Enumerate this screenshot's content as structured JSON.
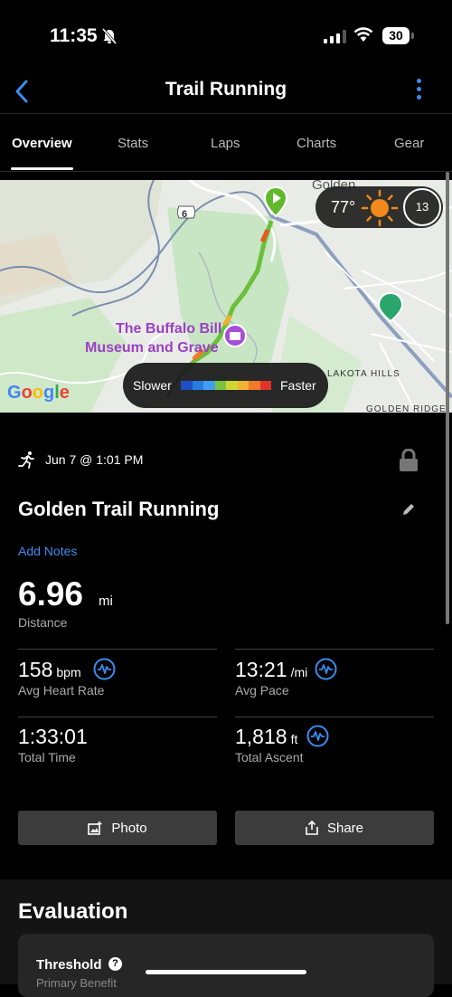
{
  "status": {
    "time": "11:35",
    "battery": "30"
  },
  "nav": {
    "title": "Trail Running"
  },
  "tabs": [
    "Overview",
    "Stats",
    "Laps",
    "Charts",
    "Gear"
  ],
  "map": {
    "weather": {
      "temp": "77°",
      "wind": "13"
    },
    "legend": {
      "slow": "Slower",
      "fast": "Faster",
      "colors": [
        "#1e4fc4",
        "#2a7be0",
        "#3fa0f0",
        "#7cc242",
        "#cfd630",
        "#f2b233",
        "#f07a2a",
        "#e03528"
      ]
    },
    "labels": {
      "route_shield": "6",
      "town": "Golden",
      "poi1": "The Buffalo Bill",
      "poi2": "Museum and Grave",
      "area1": "LAKOTA HILLS",
      "area2": "GOLDEN RIDGE"
    },
    "attribution": "Google"
  },
  "activity": {
    "date": "Jun 7 @ 1:01 PM",
    "title": "Golden Trail Running",
    "add_notes": "Add Notes",
    "distance": {
      "value": "6.96",
      "unit": "mi",
      "label": "Distance"
    }
  },
  "stats": [
    {
      "value": "158",
      "unit": "bpm",
      "label": "Avg Heart Rate"
    },
    {
      "value": "13:21",
      "unit": "/mi",
      "label": "Avg Pace"
    },
    {
      "value": "1:33:01",
      "unit": "",
      "label": "Total Time"
    },
    {
      "value": "1,818",
      "unit": "ft",
      "label": "Total Ascent"
    }
  ],
  "buttons": {
    "photo": "Photo",
    "share": "Share"
  },
  "evaluation": {
    "title": "Evaluation",
    "threshold": "Threshold",
    "help": "?",
    "primary_benefit": "Primary Benefit"
  },
  "colors": {
    "accent": "#3a8df0",
    "background": "#000000",
    "button": "#3c3c3c"
  }
}
